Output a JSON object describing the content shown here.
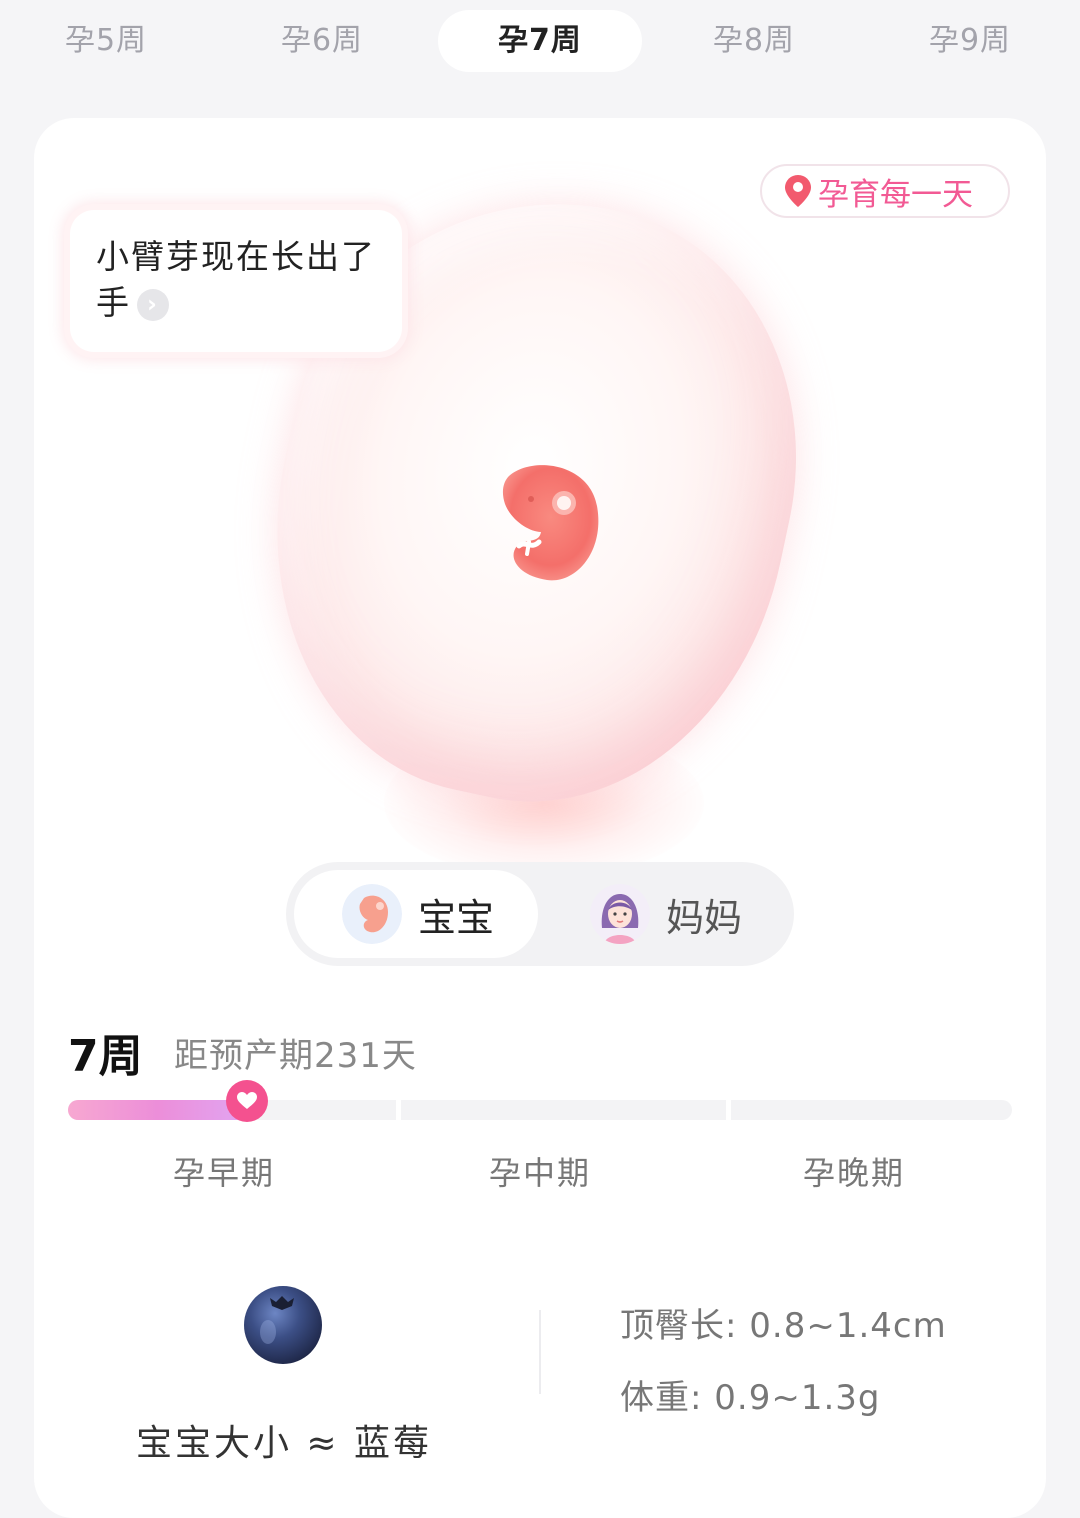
{
  "week_tabs": [
    {
      "label": "孕5周",
      "active": false
    },
    {
      "label": "孕6周",
      "active": false
    },
    {
      "label": "孕7周",
      "active": true
    },
    {
      "label": "孕8周",
      "active": false
    },
    {
      "label": "孕9周",
      "active": false
    }
  ],
  "daily_badge": {
    "label": "孕育每一天",
    "icon": "location-pin-icon"
  },
  "tip": {
    "text": "小臂芽现在长出了手",
    "arrow_icon": "chevron-right-icon"
  },
  "toggle": {
    "baby_label": "宝宝",
    "mom_label": "妈妈",
    "selected": "baby"
  },
  "progress": {
    "week": "7周",
    "due_text": "距预产期231天",
    "trimesters": [
      "孕早期",
      "孕中期",
      "孕晚期"
    ],
    "current_fraction": 0.19
  },
  "size": {
    "fruit_label": "宝宝大小 ≈ 蓝莓",
    "crown_rump": "顶臀长: 0.8~1.4cm",
    "weight": "体重: 0.9~1.3g"
  },
  "colors": {
    "accent_pink": "#f25a94",
    "progress_gradient_start": "#f7a8d1",
    "progress_gradient_end": "#e1a5f2",
    "background": "#f5f5f7"
  }
}
